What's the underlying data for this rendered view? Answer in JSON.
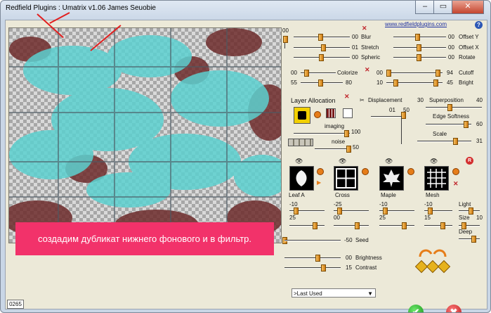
{
  "window": {
    "title": "Redfield Plugins : Umatrix v1.06   James Seuobie",
    "controls": [
      "–",
      "▭",
      "✕"
    ]
  },
  "link": "www.redfieldplugins.com",
  "help": "?",
  "preview_counter": "0265",
  "banner_text": "создадим дубликат нижнего фонового и в фильтр.",
  "top_value": "00",
  "sliders": {
    "blur": {
      "label": "Blur",
      "value": "00"
    },
    "stretch": {
      "label": "Stretch",
      "value": "01"
    },
    "spheric": {
      "label": "Spheric",
      "value": "00"
    },
    "offset_y": {
      "label": "Offset Y",
      "value": "00"
    },
    "offset_x": {
      "label": "Offset X",
      "value": "00"
    },
    "rotate": {
      "label": "Rotate",
      "value": "00"
    },
    "colorize_a": {
      "value": "00"
    },
    "colorize_label": "Colorize",
    "colorize_b": {
      "value": "55"
    },
    "colorize_c": {
      "value": "80"
    },
    "cutoff_left": {
      "value": "00"
    },
    "cutoff": {
      "label": "Cutoff",
      "value": "94"
    },
    "bright_left": {
      "value": "10"
    },
    "bright": {
      "label": "Bright",
      "value": "45"
    }
  },
  "layer_allocation": "Layer Allocation",
  "imaging": {
    "label": "imaging",
    "value": "100"
  },
  "noise": {
    "label": "noise",
    "value": "50"
  },
  "displacement": {
    "label": "Displacement",
    "value": "30",
    "sub_value": "01",
    "vert_value": "50"
  },
  "superposition": {
    "label": "Superposition",
    "value": "40"
  },
  "edge_softness": {
    "label": "Edge Softness",
    "value": "60"
  },
  "scale": {
    "label": "Scale",
    "value": "31"
  },
  "layers": [
    {
      "name": "Leaf A",
      "v1": "-10",
      "v2": "25"
    },
    {
      "name": "Cross",
      "v1": "-25",
      "v2": "00"
    },
    {
      "name": "Maple",
      "v1": "-10",
      "v2": "25"
    },
    {
      "name": "Mesh",
      "v1": "-10",
      "v2": "15"
    }
  ],
  "light": {
    "label": "Light"
  },
  "size": {
    "label": "Size",
    "value": "10"
  },
  "deep": {
    "label": "Deep",
    "value": "00"
  },
  "seed": {
    "label": "Seed",
    "value": "-50"
  },
  "brightness": {
    "label": "Brightness",
    "value": "00"
  },
  "contrast": {
    "label": "Contrast",
    "value": "15"
  },
  "preset": {
    "value": ">Last Used"
  },
  "ok": "✔",
  "cancel": "✖",
  "r_badge": "R",
  "accent_color": "#f2326a",
  "knob_color": "#e6951d"
}
